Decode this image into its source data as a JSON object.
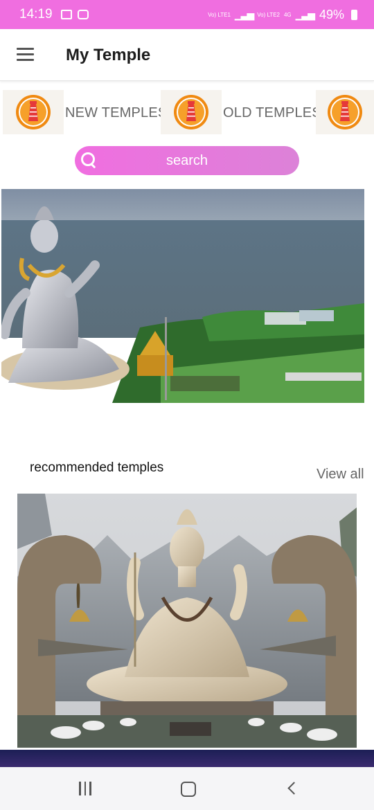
{
  "status_bar": {
    "time": "14:19",
    "sim1_label": "Vo) LTE1",
    "sim2_label": "Vo) LTE2",
    "network": "4G",
    "battery": "49%"
  },
  "app_bar": {
    "title": "My Temple",
    "menu_icon": "hamburger-menu-icon"
  },
  "categories": {
    "new_label": "NEW TEMPLES",
    "old_label": "OLD TEMPLES",
    "logo_icon": "temple-gopuram-icon"
  },
  "search": {
    "placeholder": "search",
    "icon": "search-icon"
  },
  "recommended": {
    "title": "recommended temples",
    "view_all": "View all"
  },
  "nav_bar": {
    "recents_icon": "recents-icon",
    "home_icon": "home-icon",
    "back_icon": "back-icon"
  },
  "colors": {
    "accent": "#f06ee0",
    "search_gradient_end": "#dc82d8",
    "logo_orange": "#f08a12"
  }
}
